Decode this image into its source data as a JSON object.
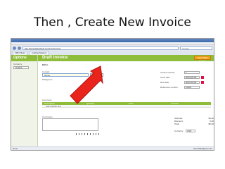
{
  "slide": {
    "title": "Then , Create New Invoice"
  },
  "browser": {
    "url": "http://www.billingbear.com/invoice/new",
    "search_placeholder": "Google",
    "tabs": [
      "Bill'n Bear",
      "Getting Started"
    ]
  },
  "app": {
    "sidebar_title": "Options",
    "sidebar_label": "Currency",
    "sidebar_select": "Default",
    "page_title": "Draft Invoice",
    "top_button": "Save Draft Invoice",
    "bill_to": "Bill to",
    "contact_label": "Contact",
    "contact_value": "Name",
    "new_button": "New",
    "edit_button": "Edit",
    "contact_sub": "Philippines",
    "fields": [
      {
        "label": "Invoice number",
        "value": "1"
      },
      {
        "label": "Issue date",
        "value": "2013-05-05"
      },
      {
        "label": "Due date",
        "value": "2013-06-05"
      },
      {
        "label": "Reference number",
        "value": "10001"
      }
    ],
    "line_items_label": "Line items",
    "grid_headers": [
      "Description",
      "Quantity",
      "Price",
      "Amount"
    ],
    "grid_row": "Add another line",
    "comments_label": "Comments",
    "totals": [
      {
        "label": "Subtotal:",
        "value": "$0.00"
      },
      {
        "label": "Discount:",
        "value": "0.00"
      },
      {
        "label": "Total:",
        "value": "$0.00"
      }
    ],
    "currency_label": "Currency:",
    "currency_value": "USD",
    "status_left": "Done",
    "status_right": "www.billingbear.com"
  },
  "colors": {
    "brand_green": "#8ebc3b",
    "arrow_red": "#e8241c",
    "accent_orange": "#f0a41c"
  }
}
